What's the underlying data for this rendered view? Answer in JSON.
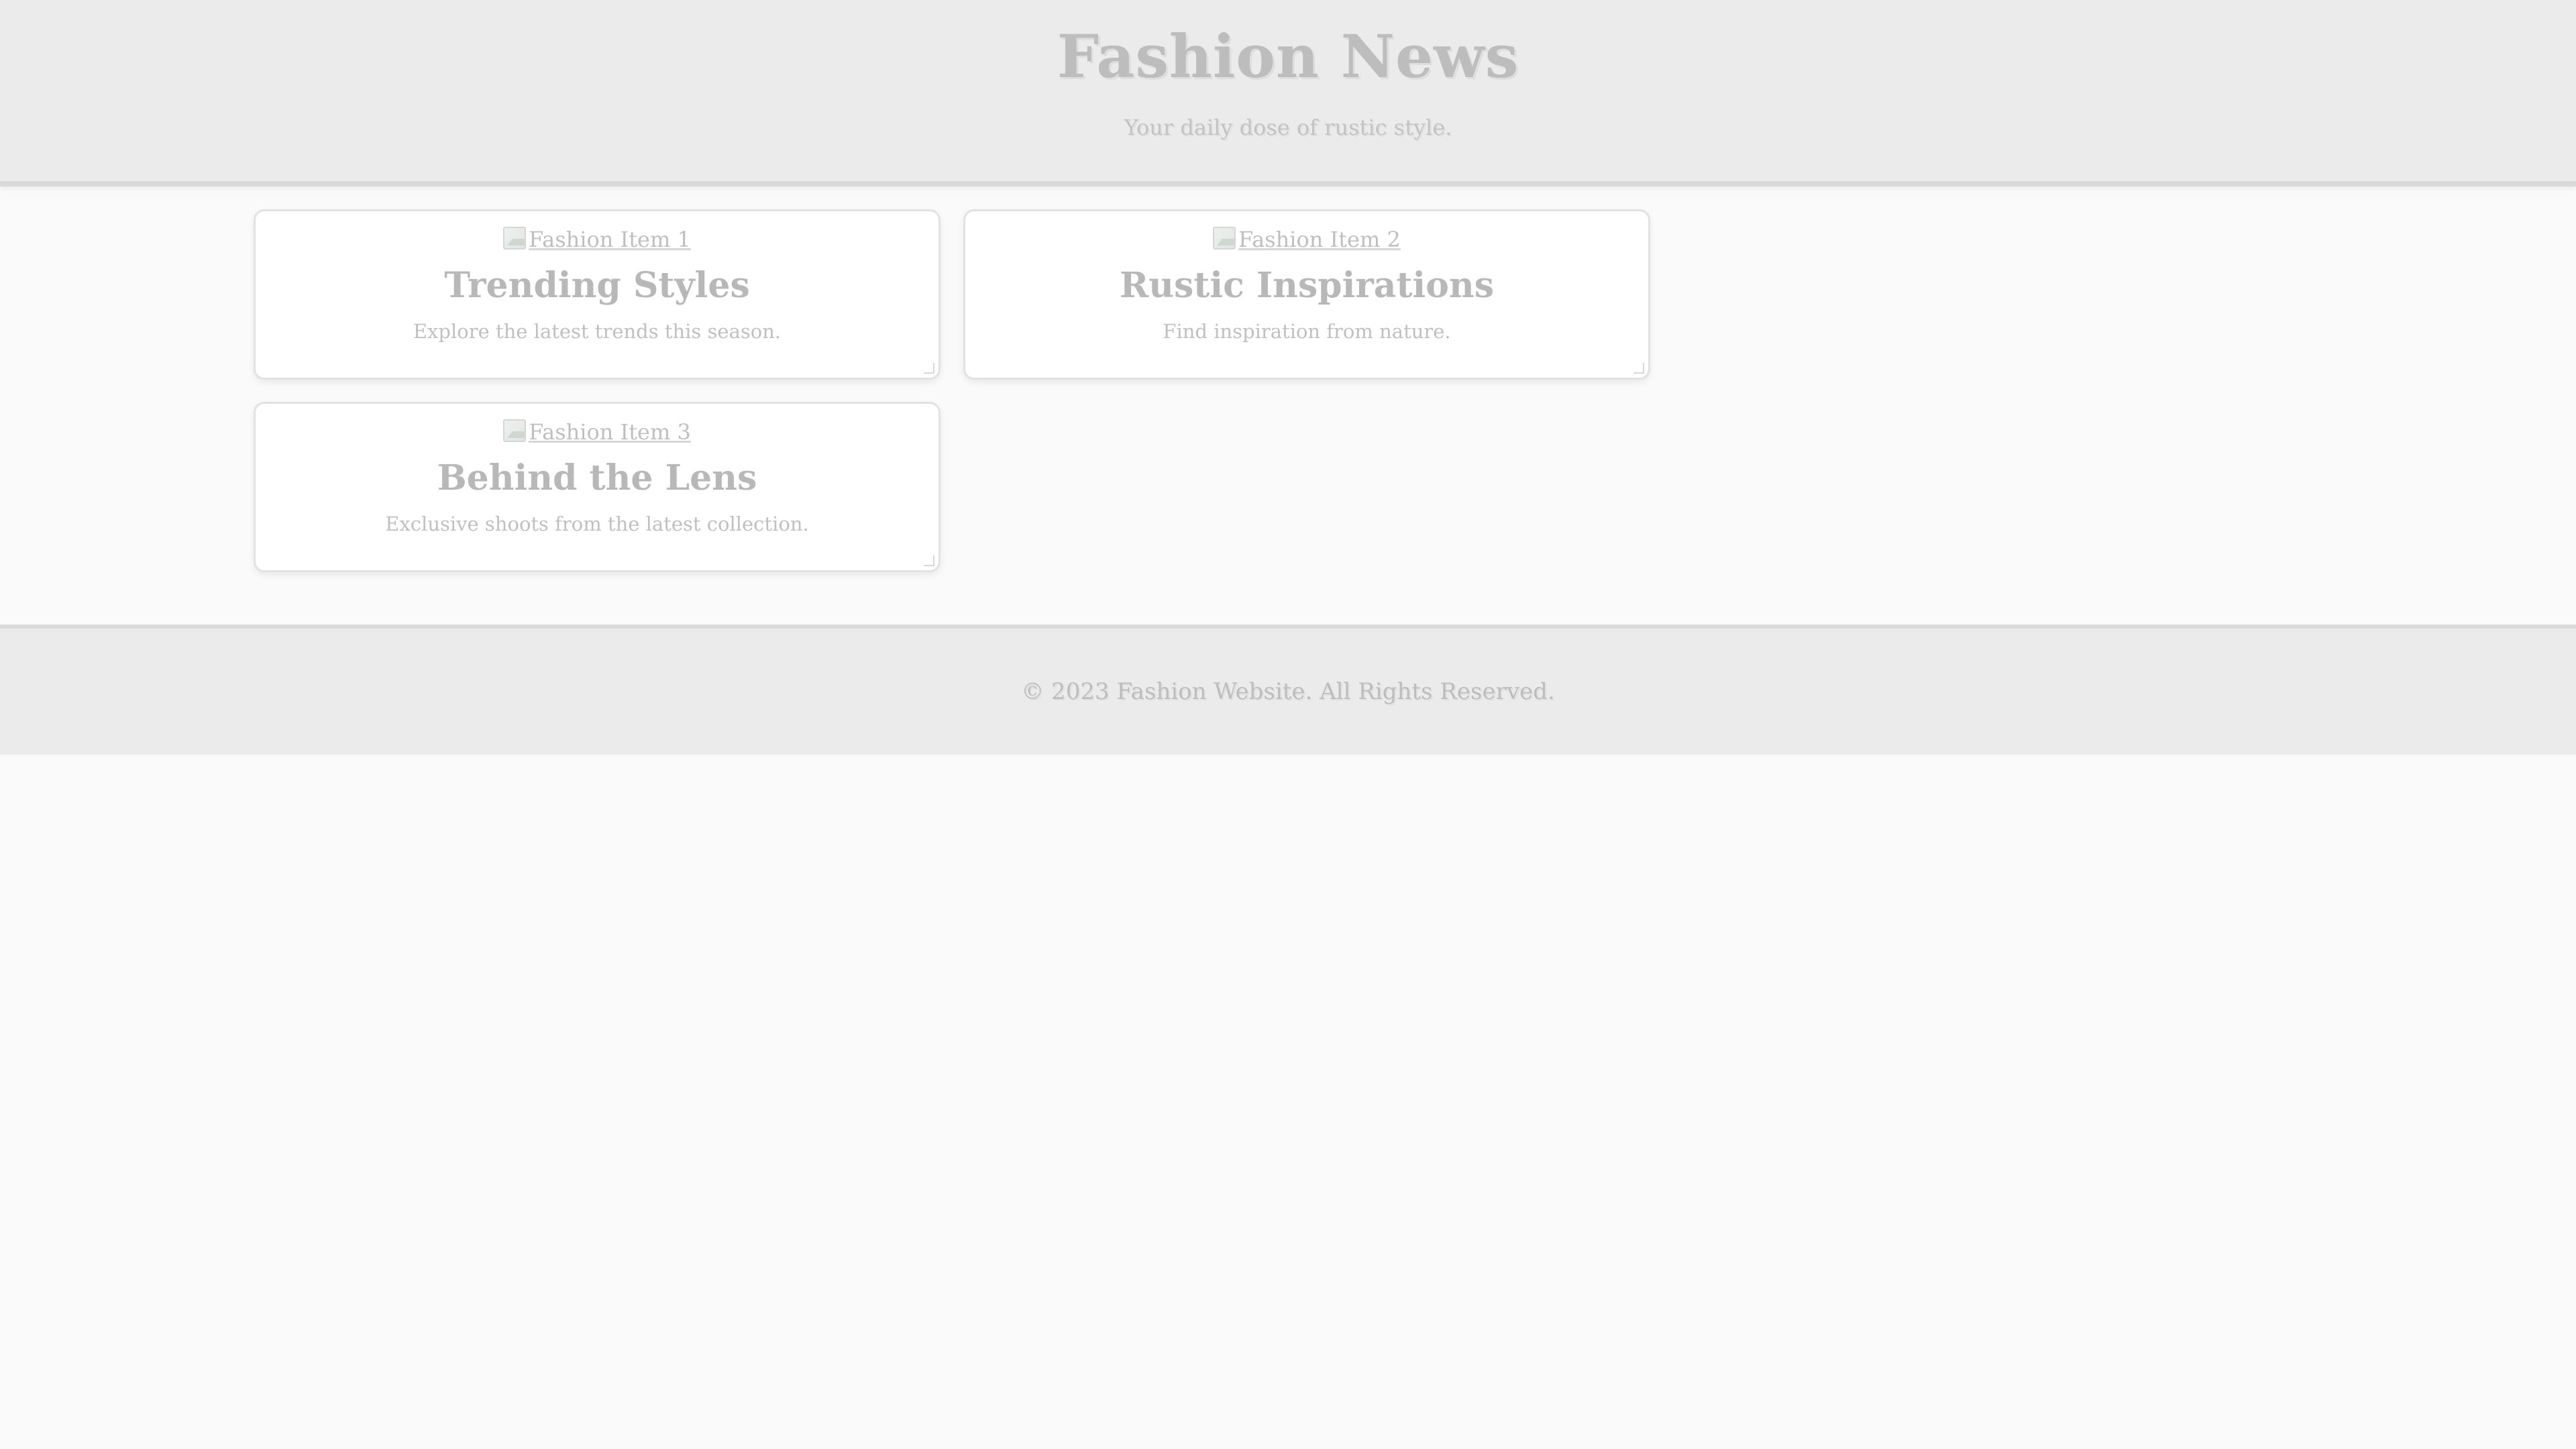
{
  "header": {
    "title": "Fashion News",
    "subtitle": "Your daily dose of rustic style."
  },
  "articles": [
    {
      "image_alt": "Fashion Item 1",
      "title": "Trending Styles",
      "text": "Explore the latest trends this season."
    },
    {
      "image_alt": "Fashion Item 2",
      "title": "Rustic Inspirations",
      "text": "Find inspiration from nature."
    },
    {
      "image_alt": "Fashion Item 3",
      "title": "Behind the Lens",
      "text": "Exclusive shoots from the latest collection."
    }
  ],
  "footer": {
    "text": "© 2023 Fashion Website. All Rights Reserved."
  },
  "icons": {
    "broken_image": "broken-image-icon"
  }
}
